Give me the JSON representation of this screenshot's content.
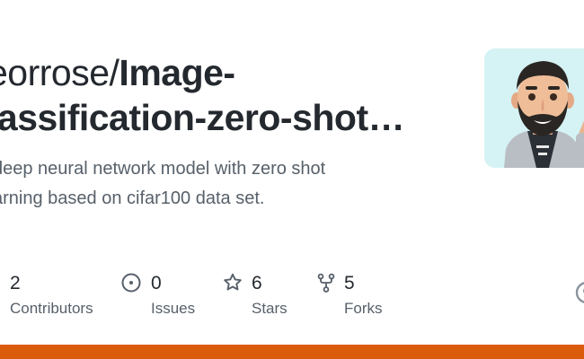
{
  "repo": {
    "owner": "eorrose/",
    "name_line1": "Image-",
    "name_line2": "lassification-zero-shot…"
  },
  "description": {
    "line1": "deep neural network model with zero shot",
    "line2": "arning based on cifar100 data set."
  },
  "stats": [
    {
      "count": "2",
      "label": "Contributors",
      "icon": "people-icon"
    },
    {
      "count": "0",
      "label": "Issues",
      "icon": "issue-opened-icon"
    },
    {
      "count": "6",
      "label": "Stars",
      "icon": "star-icon"
    },
    {
      "count": "5",
      "label": "Forks",
      "icon": "repo-forked-icon"
    }
  ],
  "avatar": {
    "icon": "memoji-avatar",
    "background": "#d5f2f4"
  },
  "edge_icon": "github-mark-icon",
  "language_bar": [
    {
      "color": "#da5b0b",
      "fraction": 1.0
    }
  ],
  "colors": {
    "title": "#24292f",
    "muted": "#57606a",
    "icon": "#57606a"
  }
}
